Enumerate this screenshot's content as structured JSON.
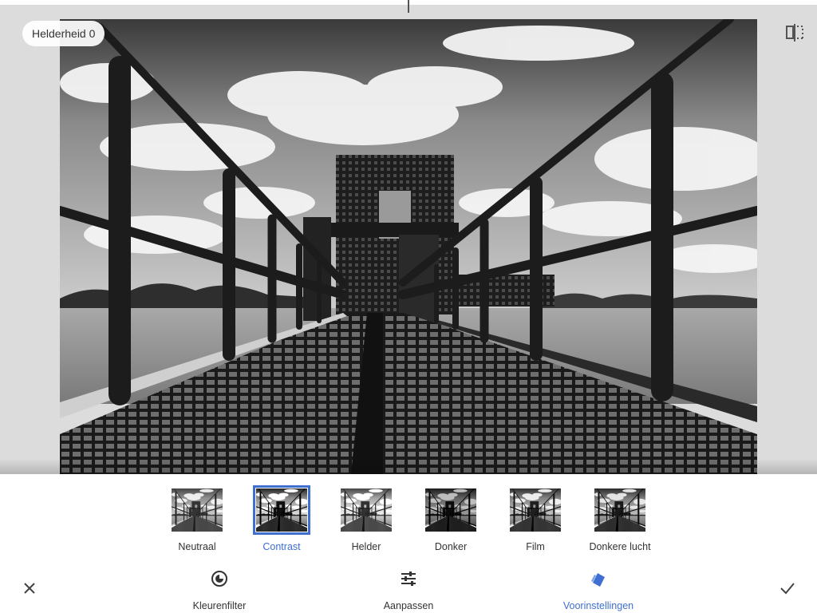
{
  "preview": {
    "parameter_label": "Helderheid 0",
    "compare_icon": "compare-split-icon"
  },
  "filters": [
    {
      "label": "Neutraal",
      "selected": false,
      "tone": "neutral"
    },
    {
      "label": "Contrast",
      "selected": true,
      "tone": "contrast"
    },
    {
      "label": "Helder",
      "selected": false,
      "tone": "bright"
    },
    {
      "label": "Donker",
      "selected": false,
      "tone": "dark"
    },
    {
      "label": "Film",
      "selected": false,
      "tone": "film"
    },
    {
      "label": "Donkere lucht",
      "selected": false,
      "tone": "darksky"
    }
  ],
  "toolbar": {
    "cancel_icon": "close-icon",
    "apply_icon": "checkmark-icon",
    "items": [
      {
        "label": "Kleurenfilter",
        "icon": "color-filter-icon",
        "active": false
      },
      {
        "label": "Aanpassen",
        "icon": "tune-sliders-icon",
        "active": false
      },
      {
        "label": "Voorinstellingen",
        "icon": "presets-styles-icon",
        "active": true
      }
    ]
  },
  "colors": {
    "accent": "#3f6fd1",
    "text": "#333333",
    "canvas_background": "#dcdcdc"
  }
}
